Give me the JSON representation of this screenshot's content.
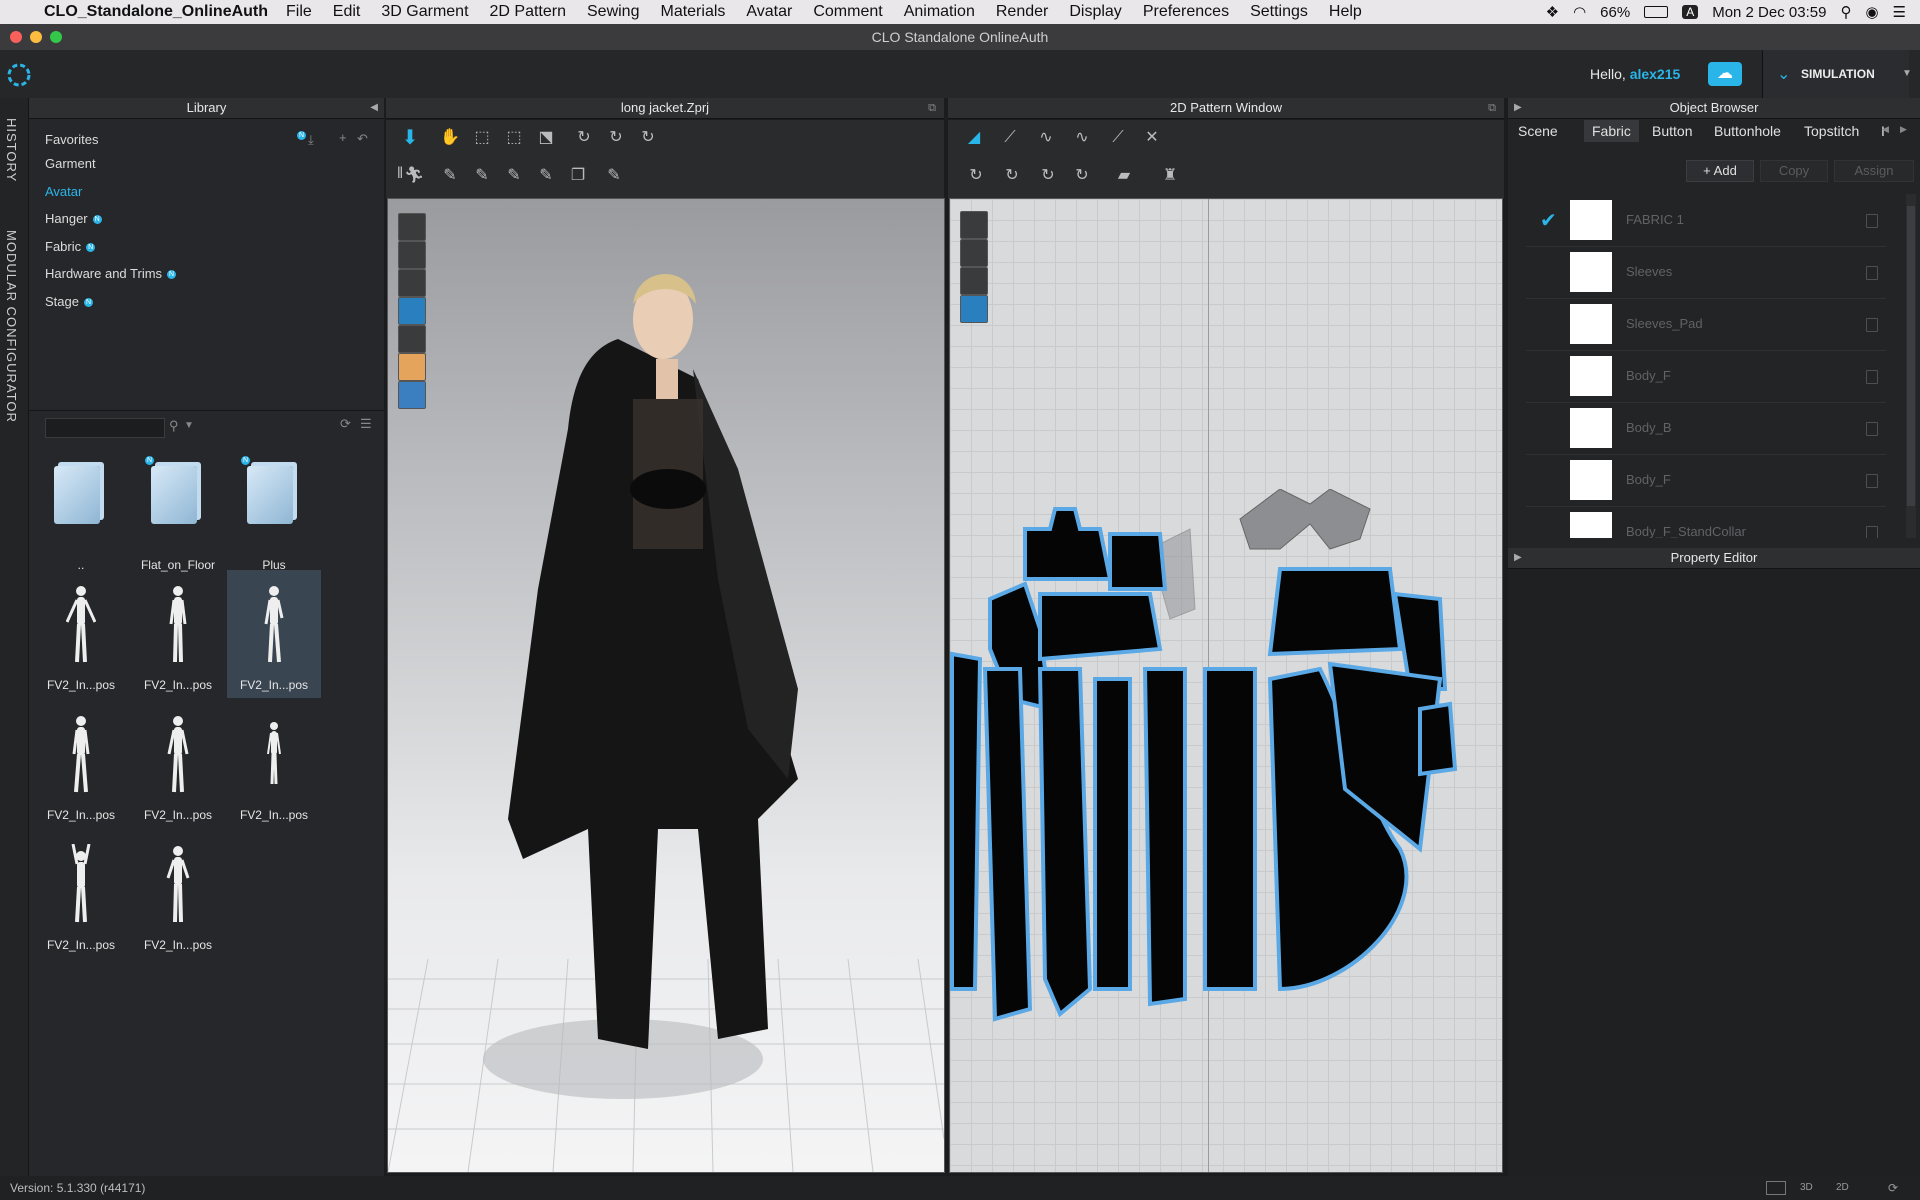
{
  "menubar": {
    "app_name": "CLO_Standalone_OnlineAuth",
    "items": [
      "File",
      "Edit",
      "3D Garment",
      "2D Pattern",
      "Sewing",
      "Materials",
      "Avatar",
      "Comment",
      "Animation",
      "Render",
      "Display",
      "Preferences",
      "Settings",
      "Help"
    ],
    "battery": "66%",
    "input_source": "A",
    "datetime": "Mon 2 Dec  03:59"
  },
  "window": {
    "title": "CLO Standalone OnlineAuth"
  },
  "header": {
    "greeting": "Hello,",
    "username": "alex215",
    "mode_label": "SIMULATION",
    "accent": "#2ab5e9"
  },
  "sidetabs": [
    "HISTORY",
    "MODULAR CONFIGURATOR"
  ],
  "library": {
    "title": "Library",
    "items": [
      {
        "label": "Favorites",
        "badge": false
      },
      {
        "label": "Garment",
        "badge": false
      },
      {
        "label": "Avatar",
        "badge": false,
        "active": true
      },
      {
        "label": "Hanger",
        "badge": true
      },
      {
        "label": "Fabric",
        "badge": true
      },
      {
        "label": "Hardware and Trims",
        "badge": true
      },
      {
        "label": "Stage",
        "badge": true
      }
    ],
    "badge_text": "N",
    "search_placeholder": "",
    "thumbnails": [
      {
        "label": "..",
        "kind": "folder",
        "badge": false
      },
      {
        "label": "Flat_on_Floor",
        "kind": "folder",
        "badge": true
      },
      {
        "label": "Plus",
        "kind": "folder",
        "badge": true
      },
      {
        "label": "FV2_In...pos",
        "kind": "avatar"
      },
      {
        "label": "FV2_In...pos",
        "kind": "avatar"
      },
      {
        "label": "FV2_In...pos",
        "kind": "avatar",
        "selected": true
      },
      {
        "label": "FV2_In...pos",
        "kind": "avatar"
      },
      {
        "label": "FV2_In...pos",
        "kind": "avatar"
      },
      {
        "label": "FV2_In...pos",
        "kind": "avatar"
      },
      {
        "label": "FV2_In...pos",
        "kind": "avatar"
      },
      {
        "label": "FV2_In...pos",
        "kind": "avatar"
      }
    ]
  },
  "viewport3d": {
    "title": "long jacket.Zprj"
  },
  "viewport2d": {
    "title": "2D Pattern Window"
  },
  "object_browser": {
    "title": "Object Browser",
    "tabs": [
      "Scene",
      "Fabric",
      "Button",
      "Buttonhole",
      "Topstitch",
      "I"
    ],
    "active_tab": "Fabric",
    "actions": [
      "Add",
      "Copy",
      "Assign"
    ],
    "fabrics": [
      {
        "name": "FABRIC 1",
        "checked": true
      },
      {
        "name": "Sleeves",
        "checked": false
      },
      {
        "name": "Sleeves_Pad",
        "checked": false
      },
      {
        "name": "Body_F",
        "checked": false
      },
      {
        "name": "Body_B",
        "checked": false
      },
      {
        "name": "Body_F",
        "checked": false
      },
      {
        "name": "Body_F_StandCollar",
        "checked": false
      }
    ]
  },
  "property_editor": {
    "title": "Property Editor"
  },
  "status": {
    "version": "Version: 5.1.330 (r44171)",
    "view_modes": [
      "3D",
      "2D"
    ]
  }
}
